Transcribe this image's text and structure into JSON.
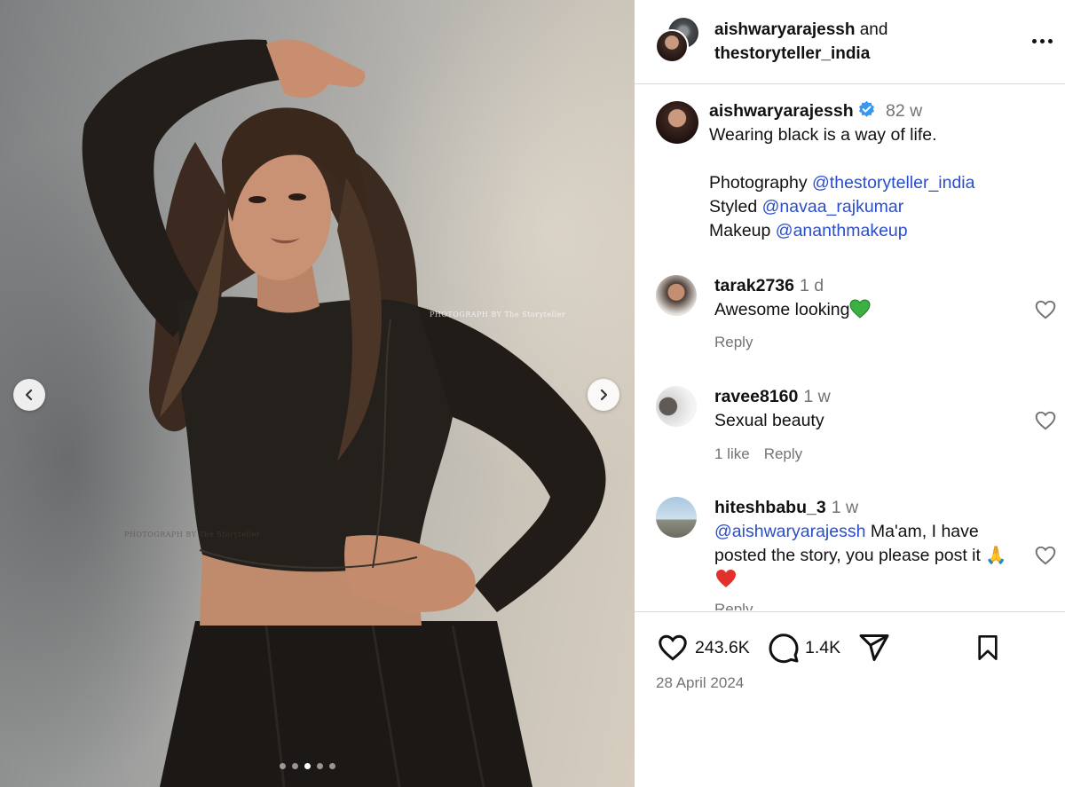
{
  "media": {
    "watermark": "PHOTOGRAPH BY The Storyteller",
    "watermark_secondary": "PHOTOGRAPH BY The Storyteller",
    "carousel": {
      "total": 5,
      "active_index": 2
    },
    "icons": {
      "prev": "chevron-left-icon",
      "next": "chevron-right-icon"
    }
  },
  "header": {
    "owner": "aishwaryarajessh",
    "joiner": "and",
    "collaborator": "thestoryteller_india",
    "more_icon": "more-horizontal-icon"
  },
  "caption": {
    "username": "aishwaryarajessh",
    "time": "82 w",
    "line1": "Wearing black is a way of life.",
    "credits": [
      {
        "label": "Photography",
        "mention": "@thestoryteller_india"
      },
      {
        "label": "Styled",
        "mention": "@navaa_rajkumar"
      },
      {
        "label": "Makeup",
        "mention": "@ananthmakeup"
      }
    ]
  },
  "comments": [
    {
      "username": "tarak2736",
      "time": "1 d",
      "text": "Awesome looking",
      "emoji": "green-heart",
      "likes": "",
      "reply": "Reply"
    },
    {
      "username": "ravee8160",
      "time": "1 w",
      "text": "Sexual beauty",
      "likes": "1 like",
      "reply": "Reply"
    },
    {
      "username": "hiteshbabu_3",
      "time": "1 w",
      "mention": "@aishwaryarajessh",
      "text": " Ma'am, I have posted the story, you please post it 🙏",
      "emoji": "red-heart",
      "reply": "Reply"
    }
  ],
  "actions": {
    "likes": "243.6K",
    "comments": "1.4K",
    "icons": [
      "heart-icon",
      "comment-icon",
      "share-icon",
      "bookmark-icon"
    ]
  },
  "date": "28 April 2024",
  "colors": {
    "link": "#2a4ec9",
    "muted": "#737373",
    "verified": "#3897f0",
    "divider": "#dbdbdb"
  }
}
